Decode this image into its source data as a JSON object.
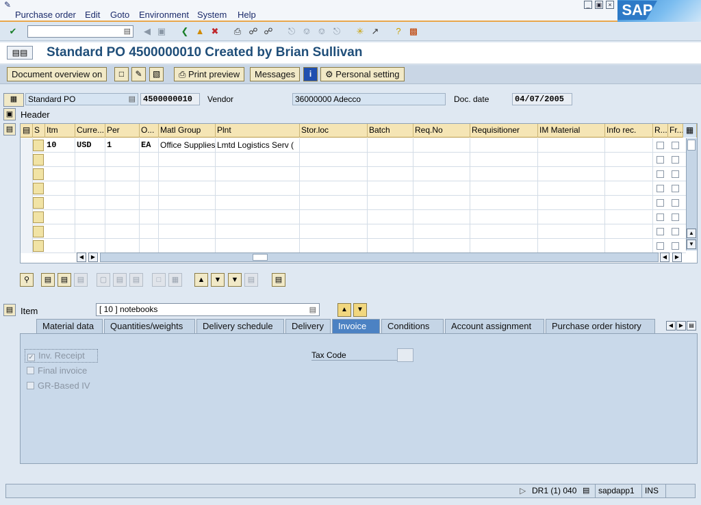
{
  "menu": {
    "items": [
      "Purchase order",
      "Edit",
      "Goto",
      "Environment",
      "System",
      "Help"
    ],
    "logo_text": "SAP"
  },
  "toolbar": {
    "command_value": "",
    "icons": [
      "enter-icon",
      "back-icon",
      "save-icon",
      "back-nav-icon",
      "exit-icon",
      "cancel-icon",
      "print-icon",
      "find-icon",
      "find-next-icon",
      "first-page-icon",
      "prev-page-icon",
      "next-page-icon",
      "last-page-icon",
      "new-session-icon",
      "shortcut-icon",
      "help-icon",
      "layout-icon"
    ]
  },
  "title": {
    "text": "Standard PO 4500000010 Created by Brian Sullivan"
  },
  "app_toolbar": {
    "document_overview": "Document overview on",
    "print_preview": "Print preview",
    "messages": "Messages",
    "personal_setting": "Personal setting"
  },
  "header": {
    "po_type": "Standard PO",
    "po_number": "4500000010",
    "vendor_label": "Vendor",
    "vendor_value": "36000000 Adecco",
    "doc_date_label": "Doc. date",
    "doc_date_value": "04/07/2005",
    "header_label": "Header"
  },
  "grid": {
    "columns": [
      "S",
      "Itm",
      "Curre...",
      "Per",
      "O...",
      "Matl Group",
      "Plnt",
      "Stor.loc",
      "Batch",
      "Req.No",
      "Requisitioner",
      "IM Material",
      "Info rec.",
      "R...",
      "Fr..."
    ],
    "rows": [
      {
        "itm": "10",
        "curr": "USD",
        "per": "1",
        "oun": "EA",
        "matl_group": "Office Supplies",
        "plnt": "Lmtd Logistics Serv (",
        "stor": "",
        "batch": "",
        "reqno": "",
        "requisitioner": "",
        "im_material": "",
        "info_rec": ""
      },
      {
        "itm": "",
        "curr": "",
        "per": "",
        "oun": "",
        "matl_group": "",
        "plnt": "",
        "stor": "",
        "batch": "",
        "reqno": "",
        "requisitioner": "",
        "im_material": "",
        "info_rec": ""
      },
      {
        "itm": "",
        "curr": "",
        "per": "",
        "oun": "",
        "matl_group": "",
        "plnt": "",
        "stor": "",
        "batch": "",
        "reqno": "",
        "requisitioner": "",
        "im_material": "",
        "info_rec": ""
      },
      {
        "itm": "",
        "curr": "",
        "per": "",
        "oun": "",
        "matl_group": "",
        "plnt": "",
        "stor": "",
        "batch": "",
        "reqno": "",
        "requisitioner": "",
        "im_material": "",
        "info_rec": ""
      },
      {
        "itm": "",
        "curr": "",
        "per": "",
        "oun": "",
        "matl_group": "",
        "plnt": "",
        "stor": "",
        "batch": "",
        "reqno": "",
        "requisitioner": "",
        "im_material": "",
        "info_rec": ""
      },
      {
        "itm": "",
        "curr": "",
        "per": "",
        "oun": "",
        "matl_group": "",
        "plnt": "",
        "stor": "",
        "batch": "",
        "reqno": "",
        "requisitioner": "",
        "im_material": "",
        "info_rec": ""
      },
      {
        "itm": "",
        "curr": "",
        "per": "",
        "oun": "",
        "matl_group": "",
        "plnt": "",
        "stor": "",
        "batch": "",
        "reqno": "",
        "requisitioner": "",
        "im_material": "",
        "info_rec": ""
      },
      {
        "itm": "",
        "curr": "",
        "per": "",
        "oun": "",
        "matl_group": "",
        "plnt": "",
        "stor": "",
        "batch": "",
        "reqno": "",
        "requisitioner": "",
        "im_material": "",
        "info_rec": ""
      }
    ]
  },
  "item": {
    "label": "Item",
    "selected": "[ 10 ] notebooks"
  },
  "tabs": [
    "Material data",
    "Quantities/weights",
    "Delivery schedule",
    "Delivery",
    "Invoice",
    "Conditions",
    "Account assignment",
    "Purchase order history"
  ],
  "active_tab": "Invoice",
  "invoice_tab": {
    "inv_receipt_label": "Inv. Receipt",
    "inv_receipt_checked": true,
    "final_invoice_label": "Final invoice",
    "final_invoice_checked": false,
    "gr_based_iv_label": "GR-Based IV",
    "gr_based_iv_checked": false,
    "tax_code_label": "Tax Code",
    "tax_code_value": ""
  },
  "status": {
    "system": "DR1 (1) 040",
    "server": "sapdapp1",
    "mode": "INS"
  },
  "colors": {
    "title": "#1f4e79",
    "active_tab": "#4c82c3",
    "grid_header": "#f5e5b5",
    "menu_accent": "#e8a64a"
  }
}
